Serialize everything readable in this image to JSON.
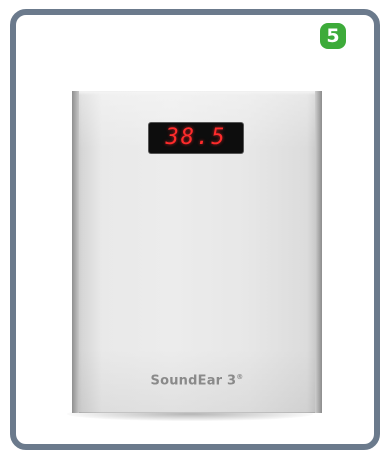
{
  "step": {
    "number": "5",
    "color": "#3dab3a"
  },
  "card": {
    "border_color": "#6b7a8c"
  },
  "device": {
    "display_value": "38.5",
    "brand_name": "SoundEar",
    "brand_model": "3",
    "brand_mark": "®"
  }
}
